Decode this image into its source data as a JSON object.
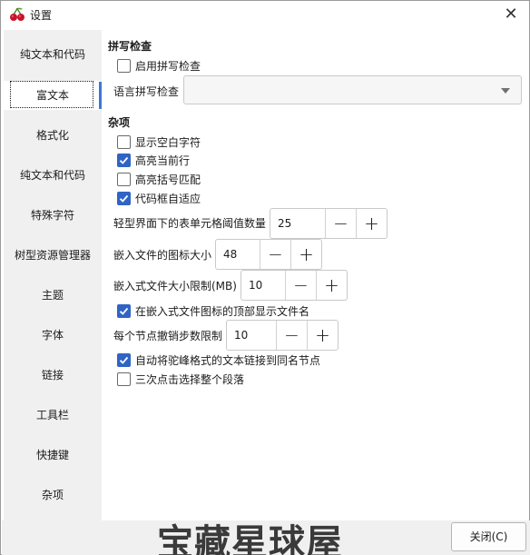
{
  "window": {
    "title": "设置"
  },
  "sidebar": {
    "items": [
      {
        "label": "纯文本和代码"
      },
      {
        "label": "富文本",
        "active": true
      },
      {
        "label": "格式化"
      },
      {
        "label": "纯文本和代码"
      },
      {
        "label": "特殊字符"
      },
      {
        "label": "树型资源管理器"
      },
      {
        "label": "主题"
      },
      {
        "label": "字体"
      },
      {
        "label": "链接"
      },
      {
        "label": "工具栏"
      },
      {
        "label": "快捷键"
      },
      {
        "label": "杂项"
      }
    ]
  },
  "spellcheck": {
    "title": "拼写检查",
    "enable_label": "启用拼写检查",
    "enable_checked": false,
    "language_label": "语言拼写检查",
    "language_value": ""
  },
  "misc": {
    "title": "杂项",
    "show_whitespace": {
      "label": "显示空白字符",
      "checked": false
    },
    "highlight_line": {
      "label": "高亮当前行",
      "checked": true
    },
    "highlight_brackets": {
      "label": "高亮括号匹配",
      "checked": false
    },
    "codebox_autofit": {
      "label": "代码框自适应",
      "checked": true
    },
    "table_threshold": {
      "label": "轻型界面下的表单元格阈值数量",
      "value": "25"
    },
    "embedded_icon_size": {
      "label": "嵌入文件的图标大小",
      "value": "48"
    },
    "embedded_max_size": {
      "label": "嵌入式文件大小限制(MB)",
      "value": "10"
    },
    "show_filename": {
      "label": "在嵌入式文件图标的顶部显示文件名",
      "checked": true
    },
    "undo_steps": {
      "label": "每个节点撤销步数限制",
      "value": "10"
    },
    "camelcase_links": {
      "label": "自动将驼峰格式的文本链接到同名节点",
      "checked": true
    },
    "triple_click": {
      "label": "三次点击选择整个段落",
      "checked": false
    }
  },
  "spinner": {
    "minus": "−",
    "plus": "+"
  },
  "footer": {
    "close_label": "关闭(C)"
  },
  "watermark": "宝藏星球屋",
  "colors": {
    "accent": "#3a78d8",
    "checkbox_checked": "#2f64c4",
    "sidebar_bg": "#f0f0f0"
  }
}
